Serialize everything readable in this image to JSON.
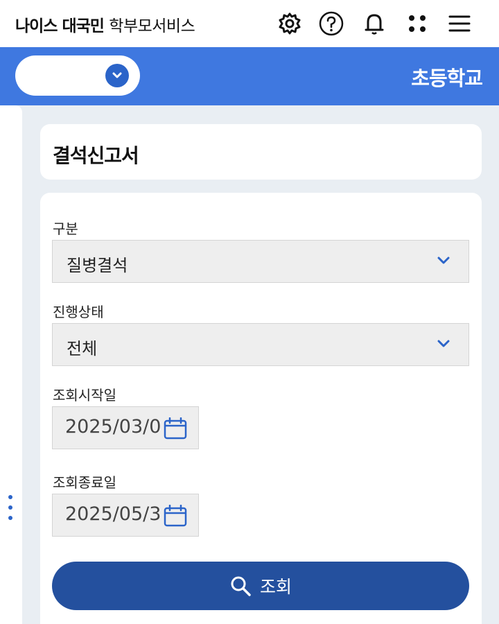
{
  "header": {
    "brand_bold": "나이스 대국민",
    "brand_light": "학부모서비스",
    "icons": [
      "gear-icon",
      "help-icon",
      "bell-icon",
      "apps-icon",
      "menu-icon"
    ]
  },
  "school_bar": {
    "selected_school": "",
    "level": "초등학교"
  },
  "page": {
    "title": "결석신고서"
  },
  "form": {
    "category_label": "구분",
    "category_value": "질병결석",
    "status_label": "진행상태",
    "status_value": "전체",
    "start_label": "조회시작일",
    "start_value": "2025/03/0",
    "end_label": "조회종료일",
    "end_value": "2025/05/3",
    "search_label": "조회"
  },
  "colors": {
    "accent_bar": "#3f78e0",
    "button": "#24509e",
    "icon_blue": "#2b64c9"
  }
}
